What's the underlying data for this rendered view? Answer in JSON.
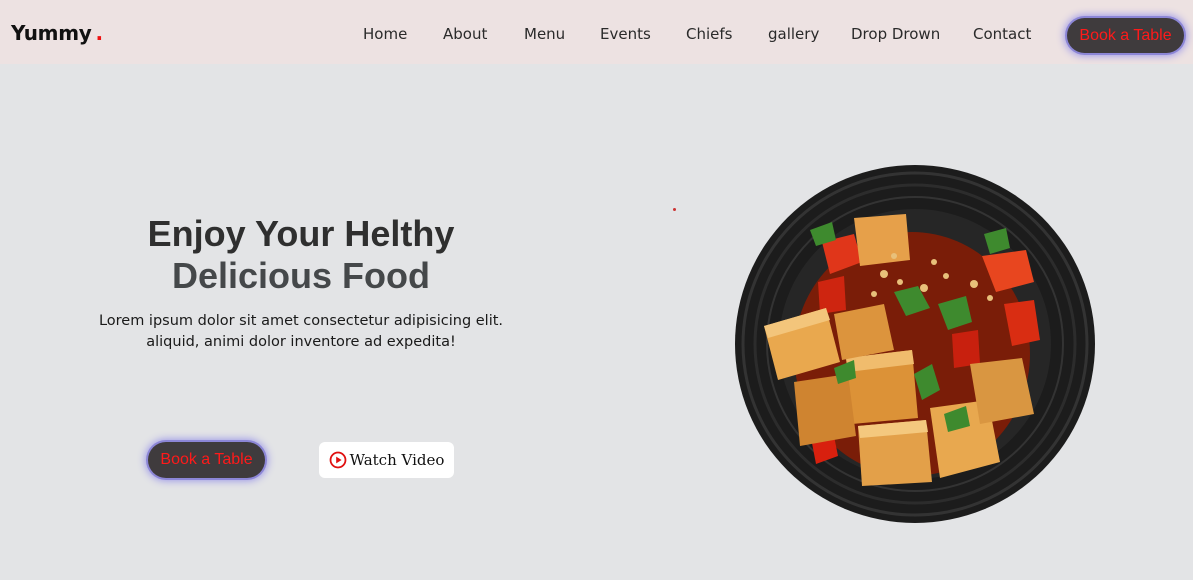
{
  "brand": {
    "name": "Yummy",
    "dot": "."
  },
  "nav": {
    "items": [
      {
        "label": "Home"
      },
      {
        "label": "About"
      },
      {
        "label": "Menu"
      },
      {
        "label": "Events"
      },
      {
        "label": "Chiefs"
      },
      {
        "label": "gallery"
      },
      {
        "label": "Drop Drown"
      },
      {
        "label": "Contact"
      }
    ],
    "cta_label": "Book a Table"
  },
  "hero": {
    "title_line1": "Enjoy Your Helthy",
    "title_line2": "Delicious Food",
    "text_line1": "Lorem ipsum dolor sit amet consectetur adipisicing elit.",
    "text_line2": "aliquid, animi dolor inventore ad expedita!",
    "book_label": "Book a Table",
    "watch_label": "Watch Video",
    "play_icon": "play-circle-icon",
    "image_icon": "food-bowl-image"
  },
  "colors": {
    "header_bg": "#ede2e2",
    "page_bg": "#e3e4e6",
    "button_bg": "#3f3b3d",
    "button_text": "#ff1a1a",
    "accent": "#e11111"
  }
}
